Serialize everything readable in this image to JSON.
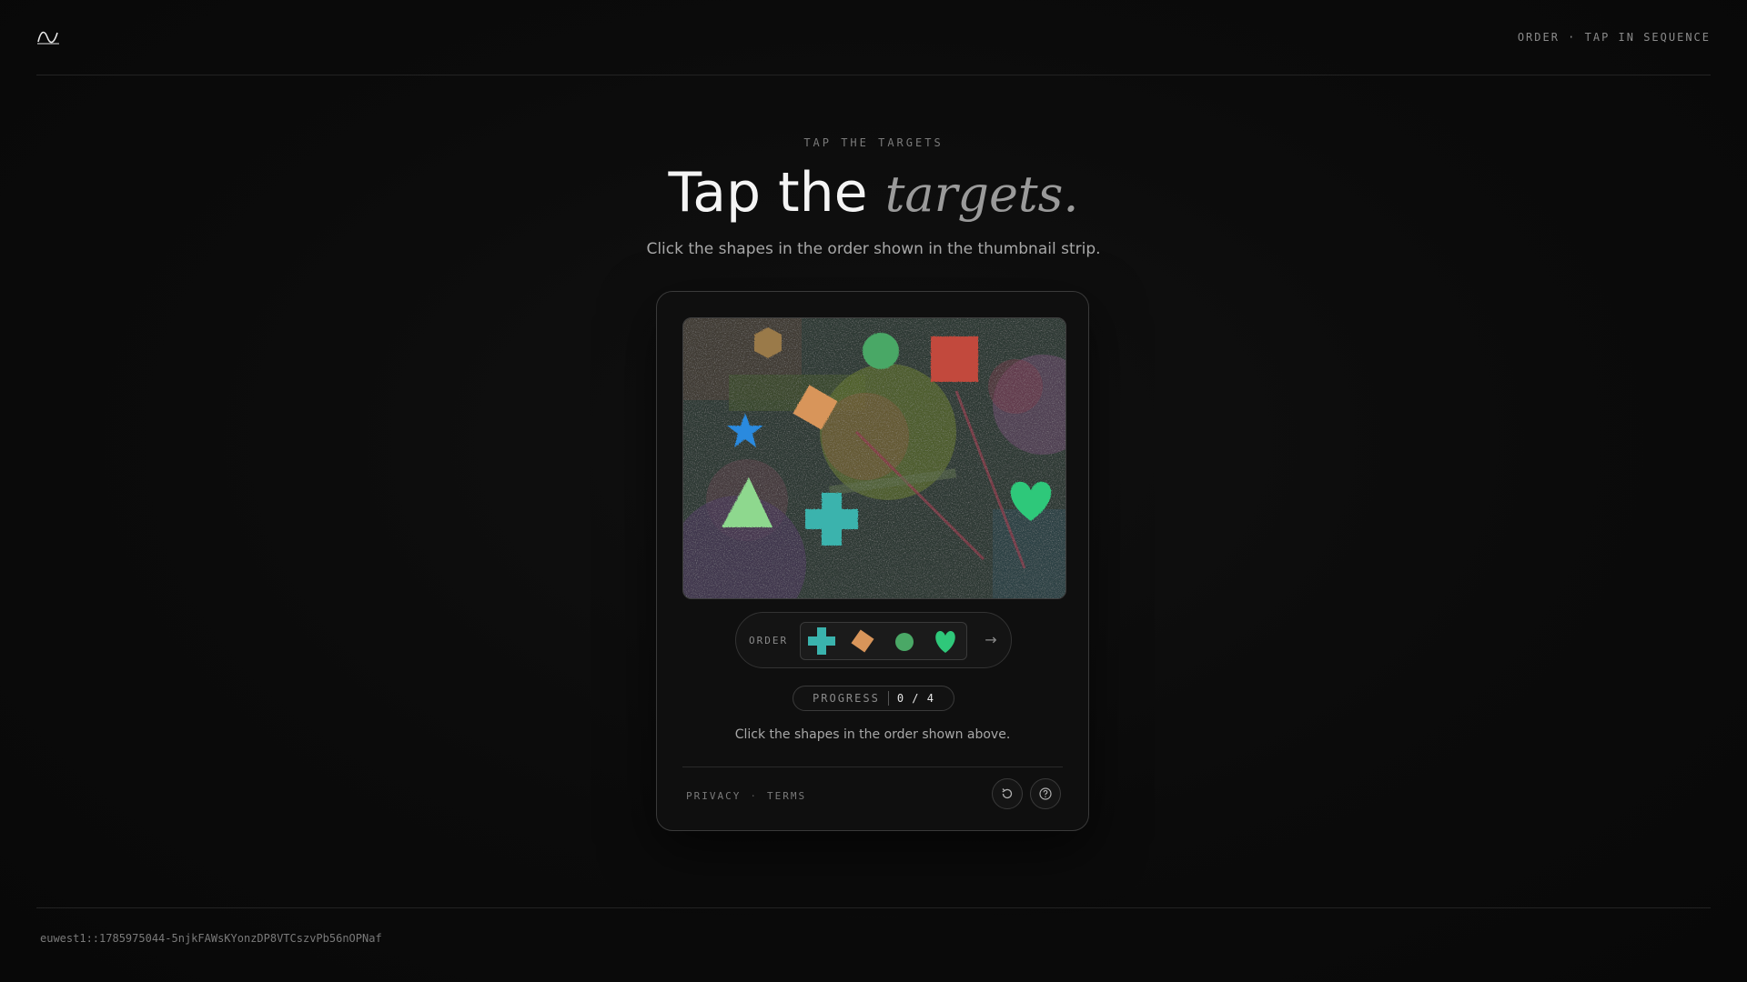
{
  "header": {
    "logo_icon": "wave-logo-icon",
    "right_label": "ORDER · TAP IN SEQUENCE"
  },
  "hero": {
    "eyebrow": "TAP THE TARGETS",
    "title_main": "Tap the",
    "title_accent": "targets.",
    "subtitle": "Click the shapes in the order shown in the thumbnail strip."
  },
  "challenge": {
    "order_label": "ORDER",
    "order_thumbnails": [
      "teal-cross",
      "orange-diamond",
      "green-circle",
      "green-heart"
    ],
    "next_icon": "arrow-right-icon",
    "next_symbol": "→",
    "progress_label": "PROGRESS",
    "progress_value": "0 / 4",
    "progress_done": 0,
    "progress_total": 4,
    "instruction": "Click the shapes in the order shown above.",
    "shapes": [
      "orange-hexagon",
      "green-circle",
      "red-square",
      "orange-diamond",
      "blue-star",
      "green-triangle",
      "teal-cross",
      "green-heart"
    ]
  },
  "footer_links": {
    "privacy": "PRIVACY",
    "separator": "·",
    "terms": "TERMS"
  },
  "actions": {
    "refresh_icon": "refresh-icon",
    "help_icon": "help-icon"
  },
  "session_id": "euwest1::1785975044-5njkFAWsKYonzDP8VTCszvPb56nOPNaf"
}
